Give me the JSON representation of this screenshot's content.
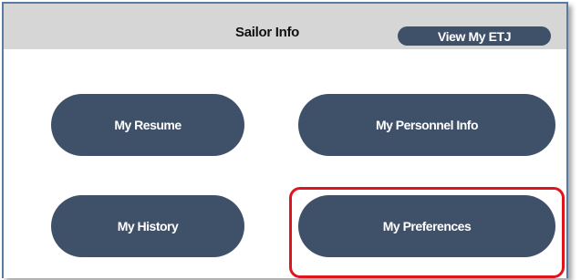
{
  "header": {
    "title": "Sailor Info",
    "etj_button_label": "View My ETJ"
  },
  "buttons": {
    "resume": "My Resume",
    "personnel": "My Personnel Info",
    "history": "My History",
    "preferences": "My Preferences"
  },
  "colors": {
    "button_fill": "#3f5069",
    "header_bg": "#d6d6d6",
    "highlight": "#e0141c",
    "panel_border": "#5b7aa0"
  }
}
